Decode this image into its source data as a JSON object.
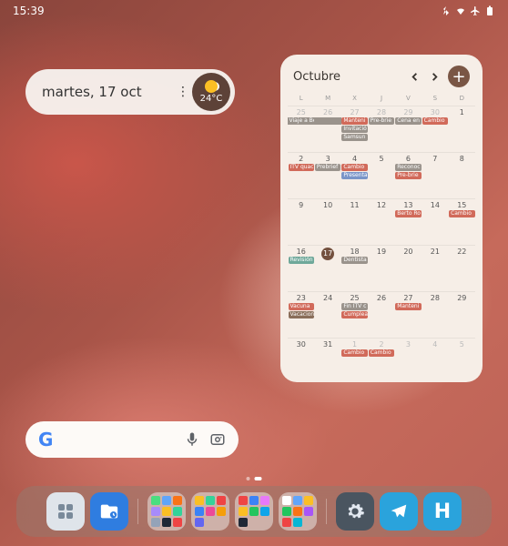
{
  "status": {
    "time": "15:39"
  },
  "pill": {
    "date": "martes, 17 oct",
    "temp": "24°C"
  },
  "calendar": {
    "month": "Octubre",
    "dow": [
      "L",
      "M",
      "X",
      "J",
      "V",
      "S",
      "D"
    ],
    "weeks": [
      [
        {
          "n": "25",
          "muted": true,
          "events": [
            {
              "t": "Viaje a Berlín - Xiao",
              "c": "gray",
              "span": true
            }
          ]
        },
        {
          "n": "26",
          "muted": true,
          "events": [
            {
              "t": "",
              "c": "gray",
              "span": true
            }
          ]
        },
        {
          "n": "27",
          "muted": true,
          "events": [
            {
              "t": "Manteni",
              "c": "red"
            },
            {
              "t": "Invitació",
              "c": "gray"
            },
            {
              "t": "Samsun",
              "c": "gray"
            }
          ]
        },
        {
          "n": "28",
          "muted": true,
          "events": [
            {
              "t": "Pre-brie",
              "c": "gray"
            }
          ]
        },
        {
          "n": "29",
          "muted": true,
          "events": [
            {
              "t": "Cena en",
              "c": "gray"
            }
          ]
        },
        {
          "n": "30",
          "muted": true,
          "events": [
            {
              "t": "Cambio",
              "c": "red"
            }
          ]
        },
        {
          "n": "1",
          "events": []
        }
      ],
      [
        {
          "n": "2",
          "events": [
            {
              "t": "ITV quac",
              "c": "red"
            }
          ]
        },
        {
          "n": "3",
          "events": [
            {
              "t": "Prebrief",
              "c": "gray"
            }
          ]
        },
        {
          "n": "4",
          "events": [
            {
              "t": "Cambio",
              "c": "red"
            },
            {
              "t": "Presenta",
              "c": "blue"
            }
          ]
        },
        {
          "n": "5",
          "events": []
        },
        {
          "n": "6",
          "events": [
            {
              "t": "Reconoc",
              "c": "gray"
            },
            {
              "t": "Pre-brie",
              "c": "red"
            }
          ]
        },
        {
          "n": "7",
          "events": []
        },
        {
          "n": "8",
          "events": []
        }
      ],
      [
        {
          "n": "9",
          "events": []
        },
        {
          "n": "10",
          "events": []
        },
        {
          "n": "11",
          "events": []
        },
        {
          "n": "12",
          "events": []
        },
        {
          "n": "13",
          "events": [
            {
              "t": "Berto Ro",
              "c": "red"
            }
          ]
        },
        {
          "n": "14",
          "events": []
        },
        {
          "n": "15",
          "events": [
            {
              "t": "Cambio",
              "c": "red"
            }
          ]
        }
      ],
      [
        {
          "n": "16",
          "events": [
            {
              "t": "Revisión",
              "c": "teal"
            }
          ]
        },
        {
          "n": "17",
          "today": true,
          "events": []
        },
        {
          "n": "18",
          "events": [
            {
              "t": "Dentista",
              "c": "gray"
            }
          ]
        },
        {
          "n": "19",
          "events": []
        },
        {
          "n": "20",
          "events": []
        },
        {
          "n": "21",
          "events": []
        },
        {
          "n": "22",
          "events": []
        }
      ],
      [
        {
          "n": "23",
          "events": [
            {
              "t": "Vacuna",
              "c": "red"
            },
            {
              "t": "Vacacion",
              "c": "brown"
            }
          ]
        },
        {
          "n": "24",
          "events": []
        },
        {
          "n": "25",
          "events": [
            {
              "t": "Fin ITV c",
              "c": "gray"
            },
            {
              "t": "Cumplea",
              "c": "red"
            }
          ]
        },
        {
          "n": "26",
          "events": []
        },
        {
          "n": "27",
          "events": [
            {
              "t": "Manteni",
              "c": "red"
            }
          ]
        },
        {
          "n": "28",
          "events": []
        },
        {
          "n": "29",
          "events": []
        }
      ],
      [
        {
          "n": "30",
          "events": []
        },
        {
          "n": "31",
          "events": []
        },
        {
          "n": "1",
          "muted": true,
          "events": [
            {
              "t": "Cambio",
              "c": "red"
            }
          ]
        },
        {
          "n": "2",
          "muted": true,
          "events": [
            {
              "t": "Cambio",
              "c": "red"
            }
          ]
        },
        {
          "n": "3",
          "muted": true,
          "events": []
        },
        {
          "n": "4",
          "muted": true,
          "events": []
        },
        {
          "n": "5",
          "muted": true,
          "events": []
        }
      ]
    ]
  }
}
